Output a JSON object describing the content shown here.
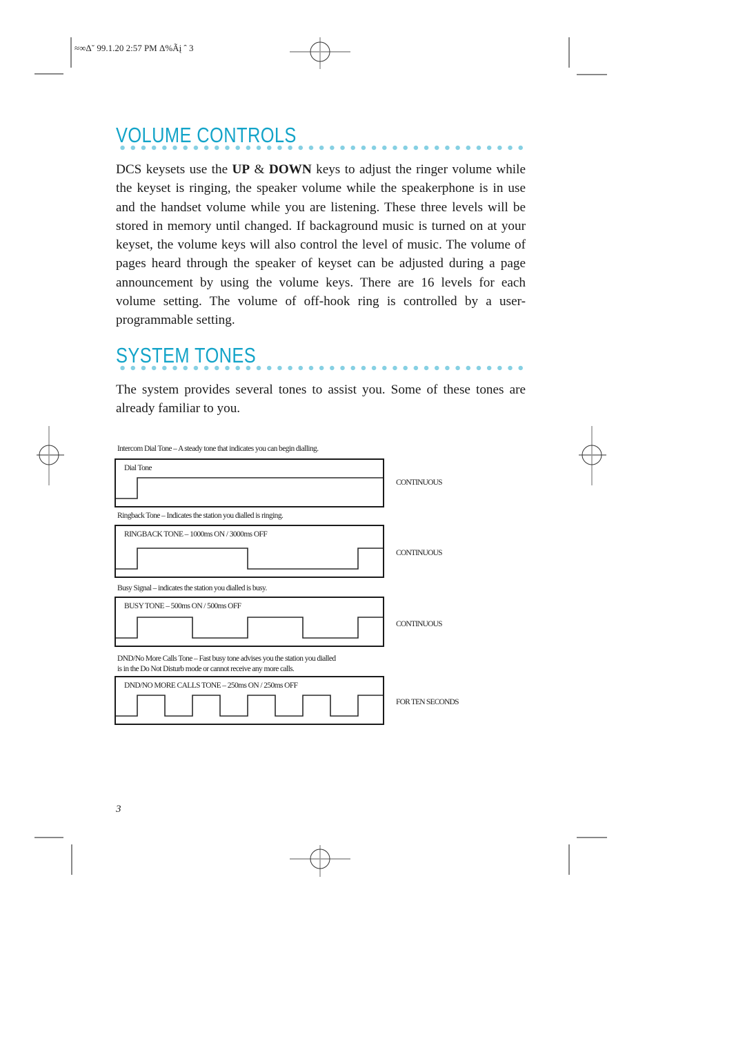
{
  "print_slug": "≈∞Δ˘  99.1.20 2:57 PM   Δ%Ãį ˆ 3",
  "sections": {
    "volume": {
      "title": "VOLUME CONTROLS",
      "paragraph": {
        "pre": "DCS keysets use the ",
        "bold1": "UP",
        "mid": " & ",
        "bold2": "DOWN",
        "post": " keys to adjust the ringer volume while the keyset is ringing, the speaker volume while the speakerphone is in use and the handset volume while you are listening. These three levels will be stored in memory until changed. If backaground music is turned on at your keyset, the volume keys will also control the level of music. The volume of pages heard through the speaker of keyset can be adjusted during a page announcement by using the volume keys. There are 16 levels for each volume setting. The volume of off-hook ring is controlled by a user-programmable setting."
      }
    },
    "tones": {
      "title": "SYSTEM TONES",
      "intro": "The system provides several tones to assist you. Some of these tones are already familiar to you."
    }
  },
  "tone_diagrams": [
    {
      "caption": "Intercom Dial Tone – A steady tone that indicates you can begin dialling.",
      "label": "Dial Tone",
      "duration": "CONTINUOUS",
      "pattern": "steady",
      "on_ms": null,
      "off_ms": null
    },
    {
      "caption": "Ringback Tone – Indicates the station you dialled is ringing.",
      "label": "RINGBACK TONE – 1000ms ON / 3000ms OFF",
      "duration": "CONTINUOUS",
      "pattern": "pulsed",
      "on_ms": 1000,
      "off_ms": 3000
    },
    {
      "caption": "Busy Signal – indicates the station you dialled is busy.",
      "label": "BUSY TONE – 500ms ON / 500ms OFF",
      "duration": "CONTINUOUS",
      "pattern": "pulsed",
      "on_ms": 500,
      "off_ms": 500
    },
    {
      "caption_line1": "DND/No More Calls Tone – Fast busy tone advises you the station you dialled",
      "caption_line2": "is in the Do Not Disturb mode or cannot receive any more calls.",
      "label": "DND/NO MORE CALLS TONE – 250ms ON / 250ms OFF",
      "duration": "FOR TEN SECONDS",
      "pattern": "pulsed",
      "on_ms": 250,
      "off_ms": 250
    }
  ],
  "page_number": "3"
}
